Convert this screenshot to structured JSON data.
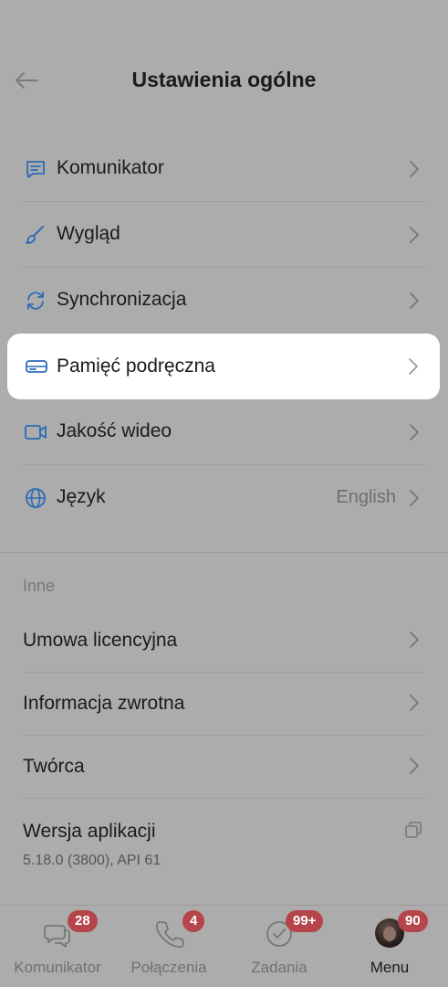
{
  "header": {
    "title": "Ustawienia ogólne"
  },
  "settings": {
    "items": [
      {
        "label": "Komunikator"
      },
      {
        "label": "Wygląd"
      },
      {
        "label": "Synchronizacja"
      },
      {
        "label": "Pamięć podręczna"
      },
      {
        "label": "Jakość wideo"
      },
      {
        "label": "Język",
        "value": "English"
      }
    ]
  },
  "other": {
    "section_title": "Inne",
    "items": [
      {
        "label": "Umowa licencyjna"
      },
      {
        "label": "Informacja zwrotna"
      },
      {
        "label": "Twórca"
      }
    ],
    "version": {
      "label": "Wersja aplikacji",
      "value": "5.18.0 (3800), API 61"
    }
  },
  "bottom_nav": {
    "items": [
      {
        "label": "Komunikator",
        "badge": "28",
        "icon": "chat-icon"
      },
      {
        "label": "Połączenia",
        "badge": "4",
        "icon": "phone-icon"
      },
      {
        "label": "Zadania",
        "badge": "99+",
        "icon": "check-circle-icon"
      },
      {
        "label": "Menu",
        "badge": "90",
        "icon": "avatar",
        "active": true
      }
    ]
  },
  "colors": {
    "accent": "#2c6bb5",
    "overlay": "#acacac",
    "badge": "#b5454a",
    "card": "#ffffff"
  }
}
